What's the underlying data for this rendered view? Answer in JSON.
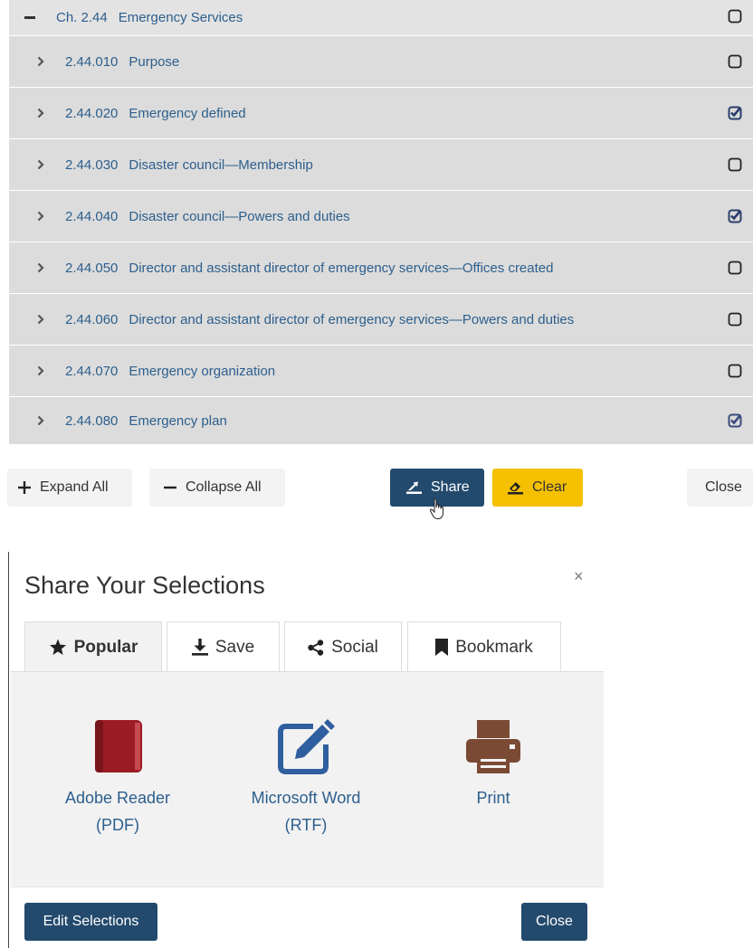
{
  "tree": {
    "chapter": {
      "number": "Ch. 2.44",
      "title": "Emergency Services",
      "checked": false
    },
    "sections": [
      {
        "number": "2.44.010",
        "title": "Purpose",
        "checked": false
      },
      {
        "number": "2.44.020",
        "title": "Emergency defined",
        "checked": true
      },
      {
        "number": "2.44.030",
        "title": "Disaster council—Membership",
        "checked": false
      },
      {
        "number": "2.44.040",
        "title": "Disaster council—Powers and duties",
        "checked": true
      },
      {
        "number": "2.44.050",
        "title": "Director and assistant director of emergency services—Offices created",
        "checked": false
      },
      {
        "number": "2.44.060",
        "title": "Director and assistant director of emergency services—Powers and duties",
        "checked": false
      },
      {
        "number": "2.44.070",
        "title": "Emergency organization",
        "checked": false
      },
      {
        "number": "2.44.080",
        "title": "Emergency plan",
        "checked": true
      }
    ]
  },
  "actions": {
    "expand_all": "Expand All",
    "collapse_all": "Collapse All",
    "share": "Share",
    "clear": "Clear",
    "close": "Close"
  },
  "modal": {
    "title": "Share Your Selections",
    "close_symbol": "×",
    "tabs": [
      {
        "label": "Popular",
        "icon": "star-icon",
        "active": true
      },
      {
        "label": "Save",
        "icon": "download-icon",
        "active": false
      },
      {
        "label": "Social",
        "icon": "share-icon",
        "active": false
      },
      {
        "label": "Bookmark",
        "icon": "bookmark-icon",
        "active": false
      }
    ],
    "options": [
      {
        "line1": "Adobe Reader",
        "line2": "(PDF)",
        "icon": "book-icon"
      },
      {
        "line1": "Microsoft Word",
        "line2": "(RTF)",
        "icon": "edit-icon"
      },
      {
        "line1": "Print",
        "line2": "",
        "icon": "printer-icon"
      }
    ],
    "edit_selections": "Edit Selections",
    "close": "Close"
  },
  "colors": {
    "link": "#2c5f8d",
    "primary": "#234a6d",
    "warning": "#f5c000",
    "pdf": "#9b1c24",
    "word": "#2f5f9e",
    "print": "#7a4a35"
  }
}
